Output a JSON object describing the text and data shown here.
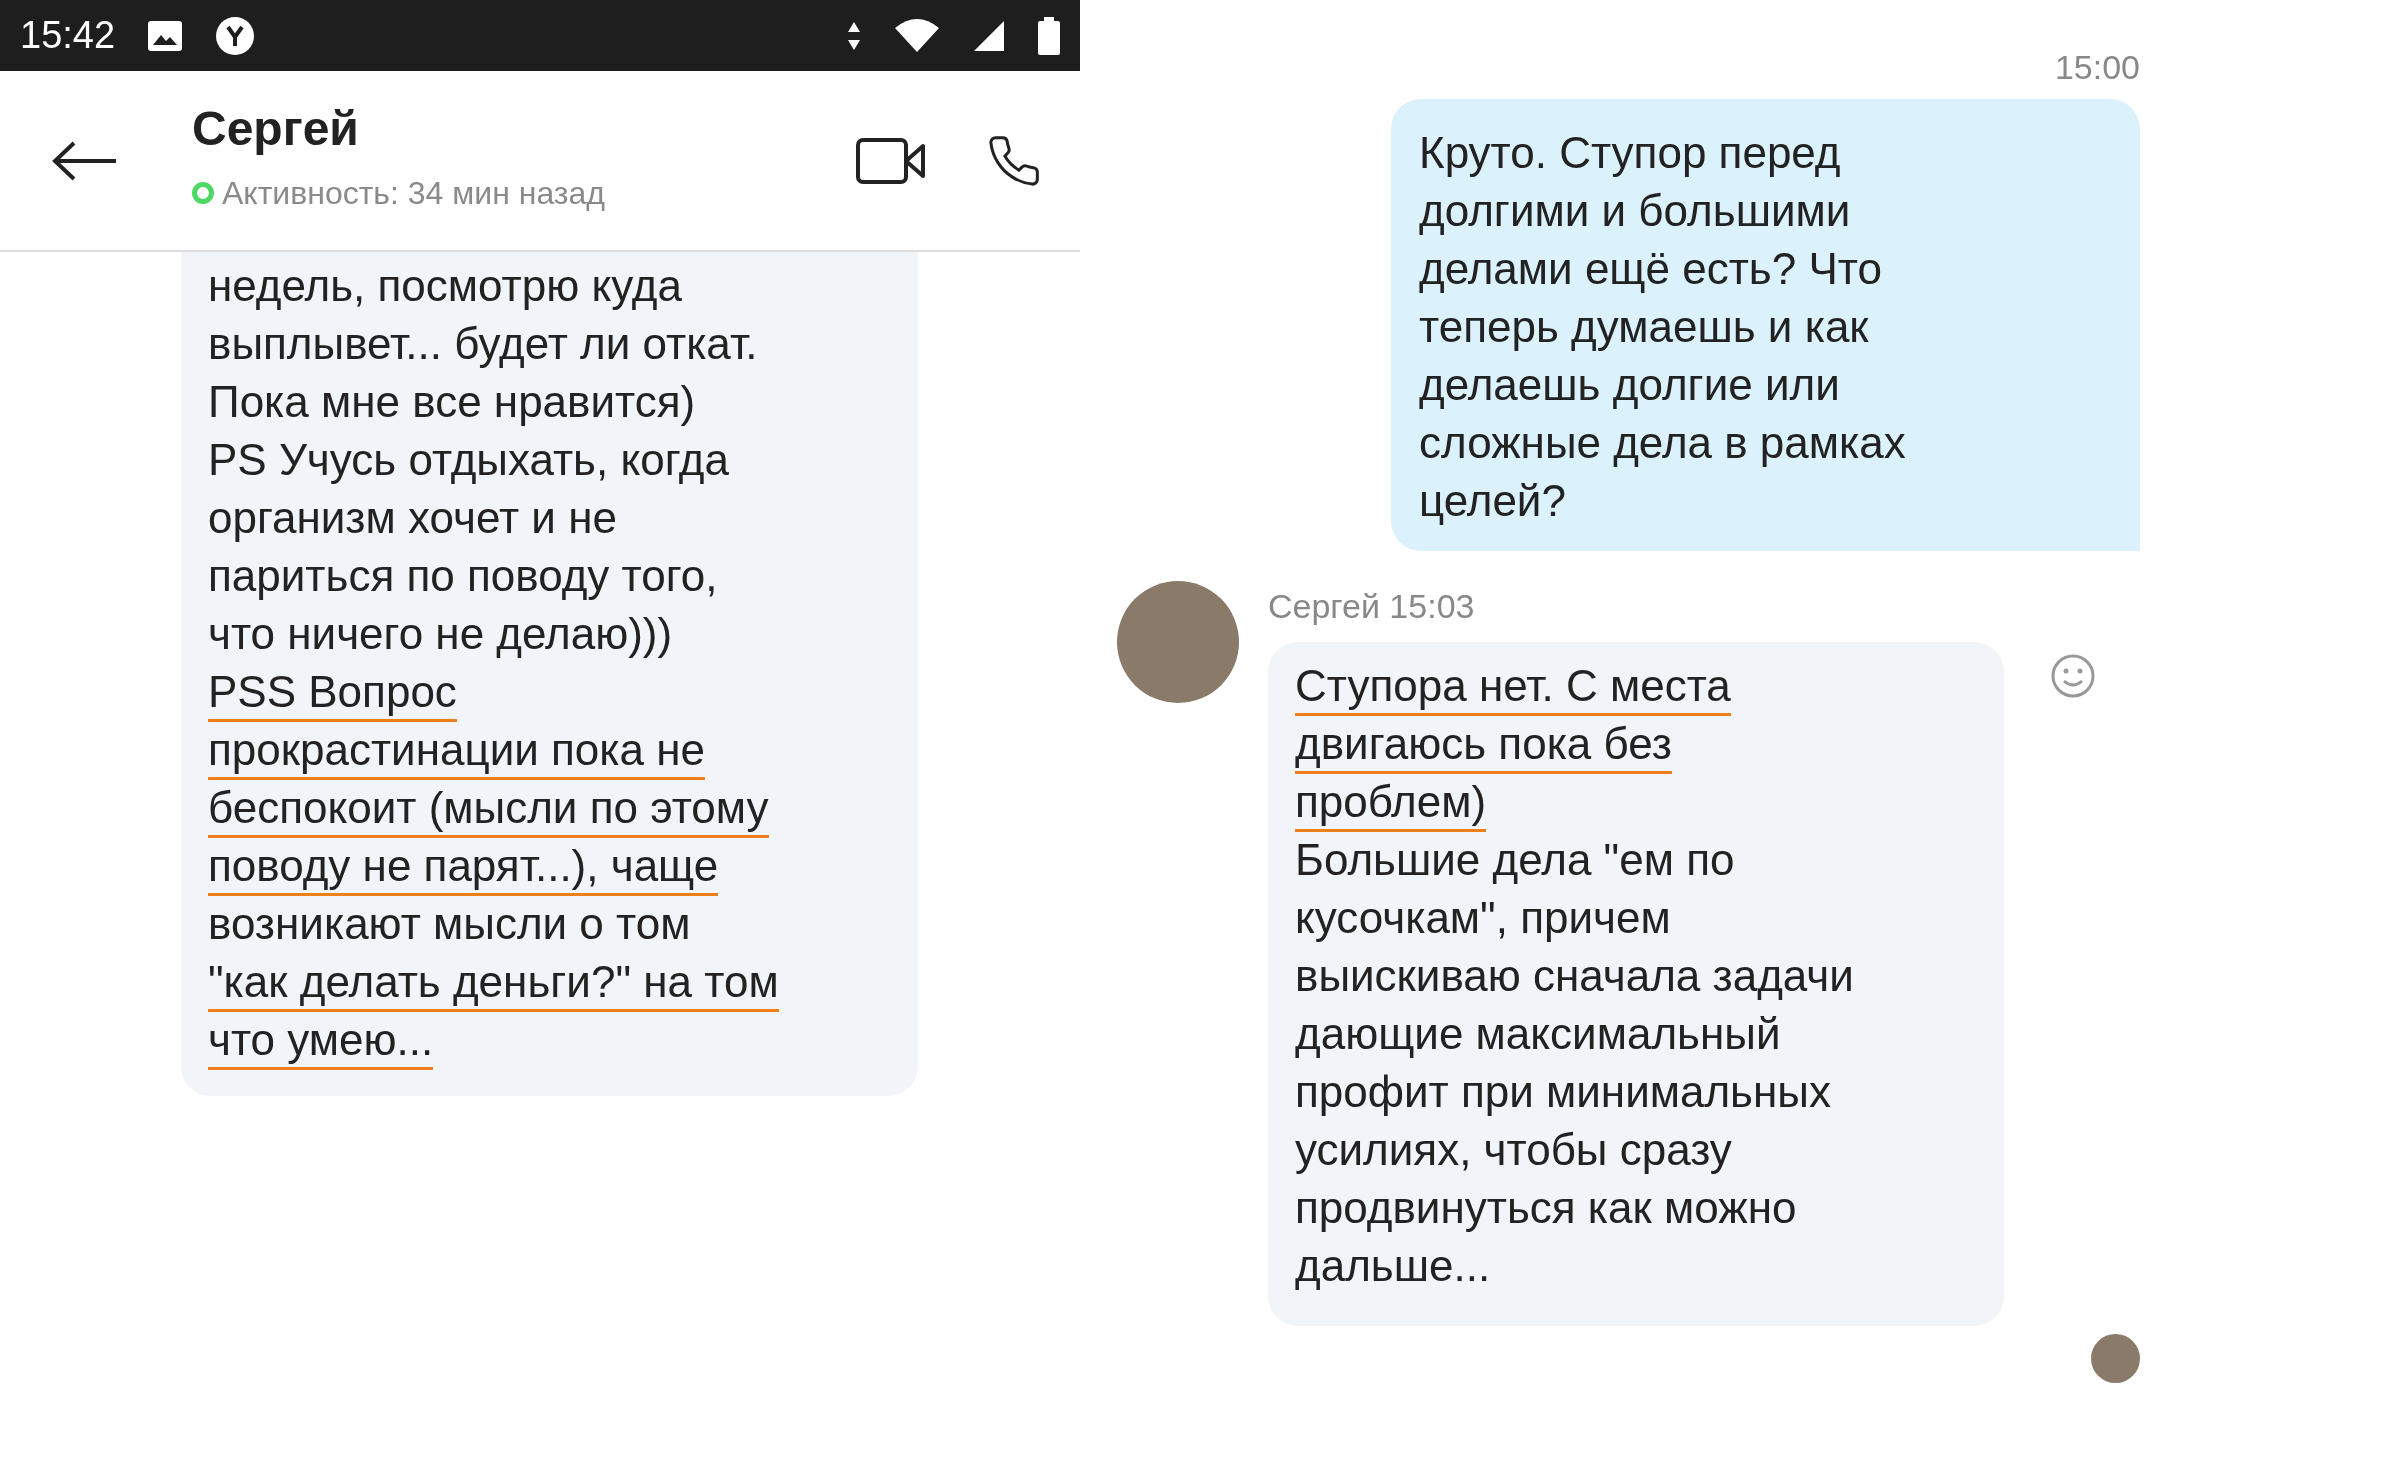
{
  "status_bar": {
    "time": "15:42"
  },
  "left_chat": {
    "contact": {
      "name": "Сергей",
      "online": true,
      "activity": "Активность: 34 мин назад"
    },
    "message": {
      "lines": [
        {
          "text": "недель, посмотрю куда",
          "underlined": false
        },
        {
          "text": "выплывет... будет ли откат.",
          "underlined": false
        },
        {
          "text": "Пока мне все нравится)",
          "underlined": false
        },
        {
          "text": "PS Учусь отдыхать, когда",
          "underlined": false
        },
        {
          "text": "организм хочет и не",
          "underlined": false
        },
        {
          "text": "париться по поводу того,",
          "underlined": false
        },
        {
          "text": "что ничего не делаю)))",
          "underlined": false
        },
        {
          "text": "PSS Вопрос",
          "underlined": true
        },
        {
          "text": "прокрастинации пока не",
          "underlined": true
        },
        {
          "text": "беспокоит (мысли по этому",
          "underlined": true
        },
        {
          "text": "поводу не парят...), чаще",
          "underlined": true
        },
        {
          "text": "возникают мысли о том",
          "underlined": false
        },
        {
          "text": "\"как делать деньги?\" на том",
          "underlined": true
        },
        {
          "text": "что умею...",
          "underlined": true
        }
      ]
    }
  },
  "right_chat": {
    "sent": {
      "time": "15:00",
      "lines": [
        {
          "text": "Круто. Ступор перед",
          "underlined": false
        },
        {
          "text": "долгими и большими",
          "underlined": false
        },
        {
          "text": "делами ещё есть? Что",
          "underlined": false
        },
        {
          "text": "теперь думаешь и как",
          "underlined": false
        },
        {
          "text": "делаешь долгие или",
          "underlined": false
        },
        {
          "text": "сложные дела в рамках",
          "underlined": false
        },
        {
          "text": "целей?",
          "underlined": false
        }
      ]
    },
    "received": {
      "sender_time": "Сергей 15:03",
      "lines": [
        {
          "text": "Ступора нет. С места",
          "underlined": true
        },
        {
          "text": "двигаюсь пока без",
          "underlined": true
        },
        {
          "text": "проблем)",
          "underlined": true
        },
        {
          "text": "Большие дела \"ем по",
          "underlined": false
        },
        {
          "text": "кусочкам\", причем",
          "underlined": false
        },
        {
          "text": "выискиваю сначала задачи",
          "underlined": false
        },
        {
          "text": "дающие максимальный",
          "underlined": false
        },
        {
          "text": "профит при минимальных",
          "underlined": false
        },
        {
          "text": "усилиях, чтобы сразу",
          "underlined": false
        },
        {
          "text": "продвинуться как можно",
          "underlined": false
        },
        {
          "text": "дальше...",
          "underlined": false
        }
      ]
    }
  }
}
